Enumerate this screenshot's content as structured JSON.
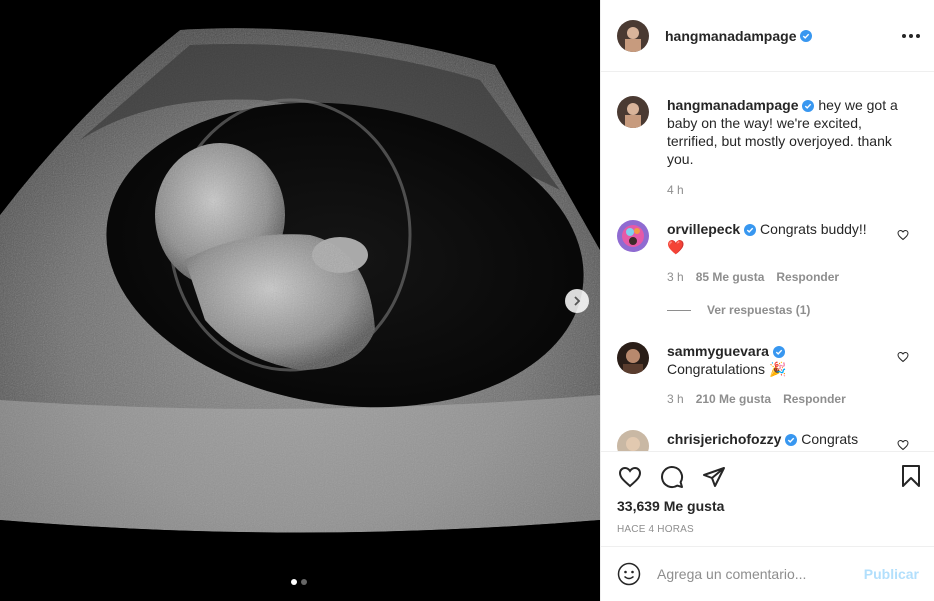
{
  "post": {
    "username": "hangmanadampage",
    "caption_username": "hangmanadampage",
    "caption": "hey we got a baby on the way! we're excited, terrified, but mostly overjoyed. thank you.",
    "caption_time": "4 h",
    "likes": "33,639 Me gusta",
    "time_ago": "HACE 4 HORAS"
  },
  "comments": [
    {
      "username": "orvillepeck",
      "text": "Congrats buddy!!",
      "emoji": "❤️",
      "time": "3 h",
      "likes": "85 Me gusta",
      "reply": "Responder",
      "view_replies": "Ver respuestas (1)"
    },
    {
      "username": "sammyguevara",
      "text": "Congratulations",
      "emoji": "🎉",
      "time": "3 h",
      "likes": "210 Me gusta",
      "reply": "Responder"
    },
    {
      "username": "chrisjerichofozzy",
      "text": "Congrats"
    }
  ],
  "composer": {
    "placeholder": "Agrega un comentario...",
    "publish": "Publicar"
  },
  "colors": {
    "verified": "#3897f0",
    "link_disabled": "#b2dffc",
    "meta": "#8e8e8e",
    "heart": "#ed4956"
  },
  "icons": [
    "more-icon",
    "verified-icon",
    "heart-icon",
    "comment-icon",
    "share-icon",
    "bookmark-icon",
    "emoji-icon",
    "chevron-right-icon"
  ],
  "carousel": {
    "count": 2,
    "active": 0
  }
}
